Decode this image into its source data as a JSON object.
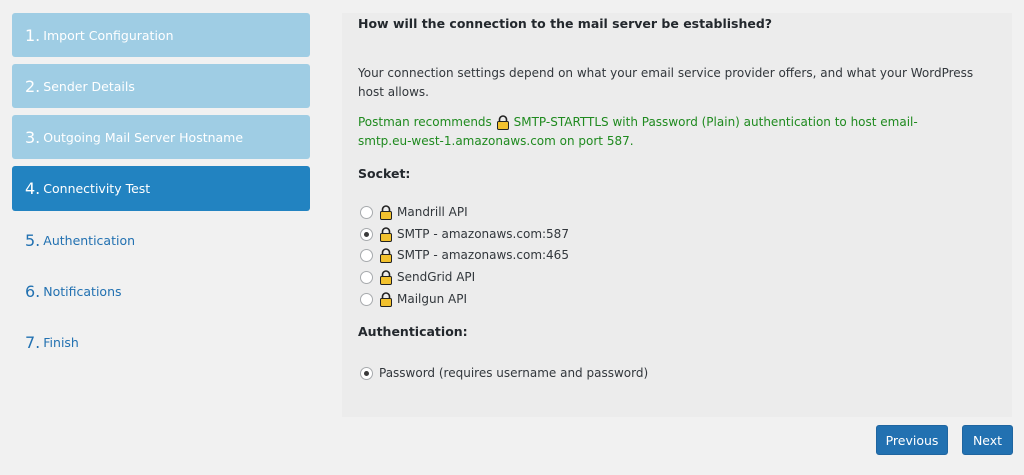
{
  "steps": [
    {
      "num": "1.",
      "label": "Import Configuration",
      "state": "done"
    },
    {
      "num": "2.",
      "label": "Sender Details",
      "state": "done"
    },
    {
      "num": "3.",
      "label": "Outgoing Mail Server Hostname",
      "state": "done"
    },
    {
      "num": "4.",
      "label": "Connectivity Test",
      "state": "current"
    },
    {
      "num": "5.",
      "label": "Authentication",
      "state": "todo"
    },
    {
      "num": "6.",
      "label": "Notifications",
      "state": "todo"
    },
    {
      "num": "7.",
      "label": "Finish",
      "state": "todo"
    }
  ],
  "content": {
    "question": "How will the connection to the mail server be established?",
    "description": "Your connection settings depend on what your email service provider offers, and what your WordPress host allows.",
    "recommend_pre": "Postman recommends ",
    "recommend_post": "SMTP-STARTTLS with Password (Plain) authentication to host email-smtp.eu-west-1.amazonaws.com on port 587.",
    "socket_title": "Socket:",
    "sockets": [
      {
        "label": "Mandrill API",
        "checked": false
      },
      {
        "label": "SMTP - amazonaws.com:587",
        "checked": true
      },
      {
        "label": "SMTP - amazonaws.com:465",
        "checked": false
      },
      {
        "label": "SendGrid API",
        "checked": false
      },
      {
        "label": "Mailgun API",
        "checked": false
      }
    ],
    "auth_title": "Authentication:",
    "auth_option": "Password (requires username and password)"
  },
  "buttons": {
    "previous": "Previous",
    "next": "Next"
  },
  "colors": {
    "accent": "#2271b1",
    "step_done": "#9fcde4",
    "step_current": "#2283c1",
    "recommend_text": "#1f8a1f",
    "lock_fill": "#f2c12e"
  }
}
